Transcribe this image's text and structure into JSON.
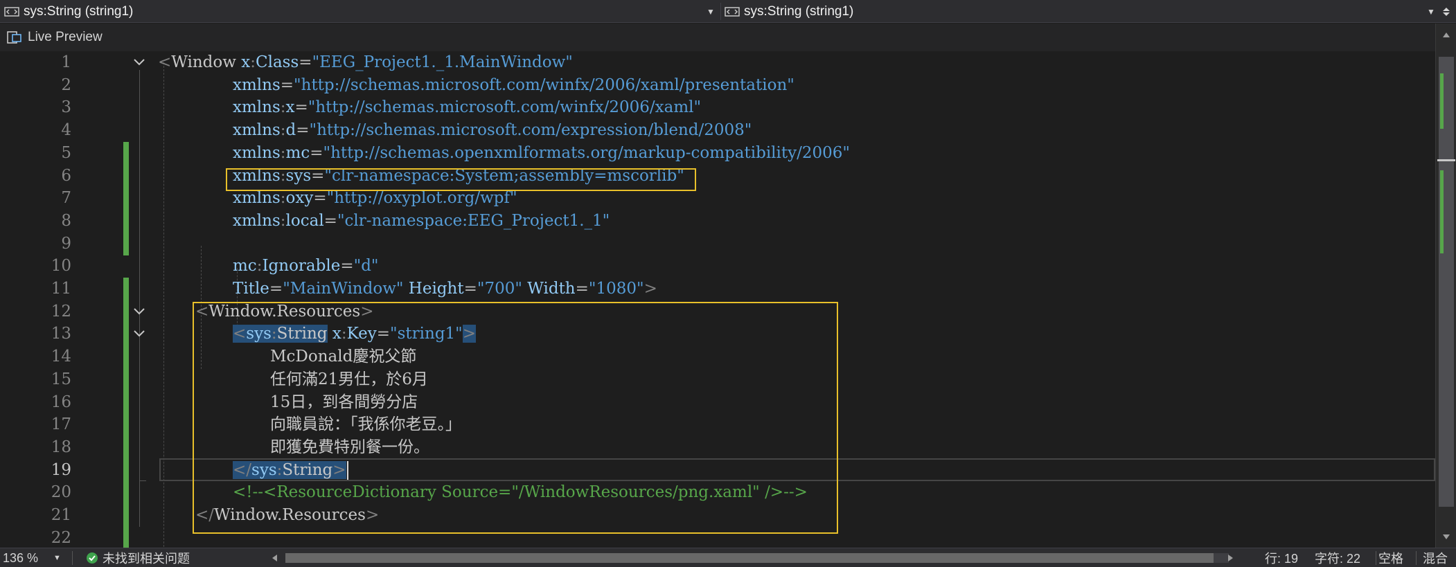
{
  "navbar": {
    "left_selector": "sys:String (string1)",
    "right_selector": "sys:String (string1)"
  },
  "toolbar": {
    "live_preview": "Live Preview"
  },
  "editor": {
    "current_line": 19,
    "code_lines": [
      {
        "n": "1",
        "tokens": [
          [
            "t-br",
            "<"
          ],
          [
            "t-el",
            "Window"
          ],
          [
            "t-txt",
            " "
          ],
          [
            "t-at",
            "x"
          ],
          [
            "t-col",
            ":"
          ],
          [
            "t-at",
            "Class"
          ],
          [
            "t-eq",
            "="
          ],
          [
            "t-val",
            "\"EEG_Project1._1.MainWindow\""
          ]
        ]
      },
      {
        "n": "2",
        "tokens": [
          [
            "t-at",
            "xmlns"
          ],
          [
            "t-eq",
            "="
          ],
          [
            "t-val",
            "\"http://schemas.microsoft.com/winfx/2006/xaml/presentation\""
          ]
        ]
      },
      {
        "n": "3",
        "tokens": [
          [
            "t-at",
            "xmlns"
          ],
          [
            "t-col",
            ":"
          ],
          [
            "t-at",
            "x"
          ],
          [
            "t-eq",
            "="
          ],
          [
            "t-val",
            "\"http://schemas.microsoft.com/winfx/2006/xaml\""
          ]
        ]
      },
      {
        "n": "4",
        "tokens": [
          [
            "t-at",
            "xmlns"
          ],
          [
            "t-col",
            ":"
          ],
          [
            "t-at",
            "d"
          ],
          [
            "t-eq",
            "="
          ],
          [
            "t-val",
            "\"http://schemas.microsoft.com/expression/blend/2008\""
          ]
        ]
      },
      {
        "n": "5",
        "tokens": [
          [
            "t-at",
            "xmlns"
          ],
          [
            "t-col",
            ":"
          ],
          [
            "t-at",
            "mc"
          ],
          [
            "t-eq",
            "="
          ],
          [
            "t-val",
            "\"http://schemas.openxmlformats.org/markup-compatibility/2006\""
          ]
        ]
      },
      {
        "n": "6",
        "tokens": [
          [
            "t-at",
            "xmlns"
          ],
          [
            "t-col",
            ":"
          ],
          [
            "t-at",
            "sys"
          ],
          [
            "t-eq",
            "="
          ],
          [
            "t-val",
            "\"clr-namespace:System;assembly=mscorlib\""
          ]
        ]
      },
      {
        "n": "7",
        "tokens": [
          [
            "t-at",
            "xmlns"
          ],
          [
            "t-col",
            ":"
          ],
          [
            "t-at",
            "oxy"
          ],
          [
            "t-eq",
            "="
          ],
          [
            "t-val",
            "\"http://oxyplot.org/wpf\""
          ]
        ]
      },
      {
        "n": "8",
        "tokens": [
          [
            "t-at",
            "xmlns"
          ],
          [
            "t-col",
            ":"
          ],
          [
            "t-at",
            "local"
          ],
          [
            "t-eq",
            "="
          ],
          [
            "t-val",
            "\"clr-namespace:EEG_Project1._1\""
          ]
        ]
      },
      {
        "n": "9",
        "tokens": []
      },
      {
        "n": "10",
        "tokens": [
          [
            "t-at",
            "mc"
          ],
          [
            "t-col",
            ":"
          ],
          [
            "t-at",
            "Ignorable"
          ],
          [
            "t-eq",
            "="
          ],
          [
            "t-val",
            "\"d\""
          ]
        ]
      },
      {
        "n": "11",
        "tokens": [
          [
            "t-at",
            "Title"
          ],
          [
            "t-eq",
            "="
          ],
          [
            "t-val",
            "\"MainWindow\""
          ],
          [
            "t-txt",
            " "
          ],
          [
            "t-at",
            "Height"
          ],
          [
            "t-eq",
            "="
          ],
          [
            "t-val",
            "\"700\""
          ],
          [
            "t-txt",
            " "
          ],
          [
            "t-at",
            "Width"
          ],
          [
            "t-eq",
            "="
          ],
          [
            "t-val",
            "\"1080\""
          ],
          [
            "t-br",
            ">"
          ]
        ]
      },
      {
        "n": "12",
        "tokens": [
          [
            "t-br",
            "<"
          ],
          [
            "t-el",
            "Window.Resources"
          ],
          [
            "t-br",
            ">"
          ]
        ]
      },
      {
        "n": "13",
        "tokens": [
          [
            "t-br hl",
            "<"
          ],
          [
            "t-ns hl",
            "sys"
          ],
          [
            "t-col hl",
            ":"
          ],
          [
            "t-el hl",
            "String"
          ],
          [
            "t-txt",
            " "
          ],
          [
            "t-at",
            "x"
          ],
          [
            "t-col",
            ":"
          ],
          [
            "t-at",
            "Key"
          ],
          [
            "t-eq",
            "="
          ],
          [
            "t-val",
            "\"string1\""
          ],
          [
            "t-br hl",
            ">"
          ]
        ]
      },
      {
        "n": "14",
        "tokens": [
          [
            "t-txt",
            "McDonald慶祝父節"
          ]
        ]
      },
      {
        "n": "15",
        "tokens": [
          [
            "t-txt",
            "任何滿21男仕，於6月"
          ]
        ]
      },
      {
        "n": "16",
        "tokens": [
          [
            "t-txt",
            "15日，到各間勞分店"
          ]
        ]
      },
      {
        "n": "17",
        "tokens": [
          [
            "t-txt",
            "向職員說：「我係你老豆。」"
          ]
        ]
      },
      {
        "n": "18",
        "tokens": [
          [
            "t-txt",
            "即獲免費特別餐一份。"
          ]
        ]
      },
      {
        "n": "19",
        "tokens": [
          [
            "t-br hl",
            "</"
          ],
          [
            "t-ns hl",
            "sys"
          ],
          [
            "t-col hl",
            ":"
          ],
          [
            "t-el hl",
            "String"
          ],
          [
            "t-br hl",
            ">"
          ]
        ]
      },
      {
        "n": "20",
        "tokens": [
          [
            "t-com",
            "<!--<ResourceDictionary Source=\"/WindowResources/png.xaml\" />-->"
          ]
        ]
      },
      {
        "n": "21",
        "tokens": [
          [
            "t-br",
            "</"
          ],
          [
            "t-el",
            "Window.Resources"
          ],
          [
            "t-br",
            ">"
          ]
        ]
      },
      {
        "n": "22",
        "tokens": []
      }
    ]
  },
  "statusbar": {
    "zoom": "136 %",
    "issues": "未找到相关问题",
    "line": "行: 19",
    "char": "字符: 22",
    "whitespace": "空格",
    "line_ending": "混合"
  },
  "colors": {
    "background": "#1e1e1e",
    "change_marker": "#57a64a",
    "highlight_box": "#e8c02a",
    "selection": "#264f78"
  }
}
